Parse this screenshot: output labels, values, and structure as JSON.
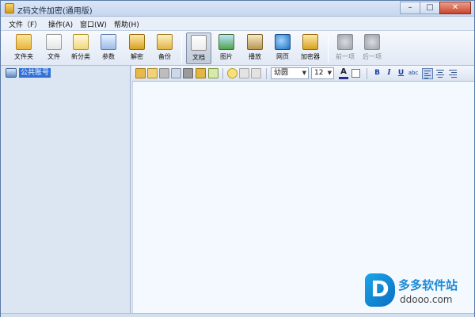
{
  "window": {
    "title": "Z码文件加密(通用版)"
  },
  "window_controls": {
    "minimize": "–",
    "maximize": "□",
    "close": "✕"
  },
  "menu": [
    {
      "label": "文件（F）"
    },
    {
      "label": "操作(A)"
    },
    {
      "label": "窗口(W)"
    },
    {
      "label": "帮助(H)"
    }
  ],
  "toolbar": {
    "items": [
      {
        "label": "文件夹",
        "icon": "folder-icon"
      },
      {
        "label": "文件",
        "icon": "file-icon"
      },
      {
        "label": "新分类",
        "icon": "category-icon"
      },
      {
        "label": "参数",
        "icon": "params-icon"
      },
      {
        "label": "解密",
        "icon": "unlock-icon"
      },
      {
        "label": "备份",
        "icon": "backup-icon"
      },
      {
        "label": "文档",
        "icon": "document-icon",
        "active": true
      },
      {
        "label": "图片",
        "icon": "image-icon"
      },
      {
        "label": "播放",
        "icon": "play-icon"
      },
      {
        "label": "网页",
        "icon": "web-icon"
      },
      {
        "label": "加密器",
        "icon": "encryptor-icon"
      },
      {
        "label": "前一项",
        "icon": "prev-icon",
        "disabled": true
      },
      {
        "label": "后一项",
        "icon": "next-icon",
        "disabled": true
      }
    ]
  },
  "tree": {
    "items": [
      {
        "label": "公共账号"
      }
    ]
  },
  "editor": {
    "font": "幼圆",
    "size": "12",
    "format": {
      "bold": "B",
      "italic": "I",
      "underline": "U",
      "strike": "abc",
      "color": "A"
    }
  },
  "watermark": {
    "mark": "D",
    "name": "多多软件站",
    "url": "ddooo.com"
  }
}
